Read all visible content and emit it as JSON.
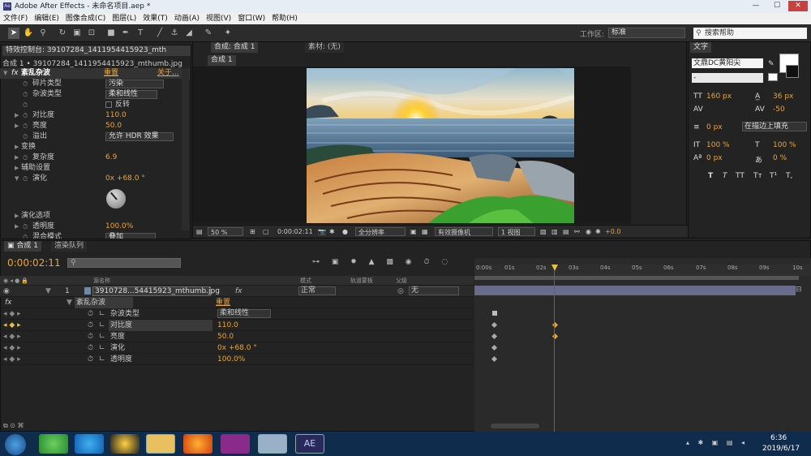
{
  "window": {
    "title": "Adobe After Effects - 未命名项目.aep *"
  },
  "menu": [
    "文件(F)",
    "编辑(E)",
    "图像合成(C)",
    "图层(L)",
    "效果(T)",
    "动画(A)",
    "视图(V)",
    "窗口(W)",
    "帮助(H)"
  ],
  "toolbar": {
    "workspace_label": "工作区:",
    "workspace_value": "标准",
    "search_placeholder": "搜索帮助"
  },
  "effect_controls": {
    "tab": "特效控制台: 39107284_1411954415923_mth",
    "subtitle": "合成 1 • 39107284_1411954415923_mthumb.jpg",
    "effect_name": "紊乱杂波",
    "reset": "重置",
    "about": "关于...",
    "rows": [
      {
        "label": "碎片类型",
        "dropdown": "污染"
      },
      {
        "label": "杂波类型",
        "dropdown": "柔和线性"
      },
      {
        "label": "",
        "checkbox": "反转"
      },
      {
        "label": "对比度",
        "value": "110.0"
      },
      {
        "label": "亮度",
        "value": "50.0"
      },
      {
        "label": "溢出",
        "dropdown": "允许 HDR 效果"
      },
      {
        "label": "变换"
      },
      {
        "label": "复杂度",
        "value": "6.9"
      },
      {
        "label": "辅助设置"
      },
      {
        "label": "演化",
        "value": "0x +68.0 °"
      },
      {
        "label": "演化选项"
      },
      {
        "label": "透明度",
        "value": "100.0%"
      },
      {
        "label": "混合模式",
        "dropdown": "叠加"
      }
    ]
  },
  "composition": {
    "tab": "合成: 合成 1",
    "footage_tab": "素材: (无)",
    "inner_tab": "合成 1",
    "zoom": "50 %",
    "timecode": "0:00:02:11",
    "resolution": "全分辨率",
    "camera": "有效摄像机",
    "views": "1 视图",
    "offset": "+0.0"
  },
  "character": {
    "tab": "文字",
    "font": "文鼎DC黄阳尖",
    "style": "-",
    "size": "160 px",
    "leading": "36 px",
    "kerning": "",
    "tracking": "-50",
    "stroke": "0 px",
    "stroke_mode": "在描边上填充",
    "vscale": "100 %",
    "hscale": "100 %",
    "baseline": "0 px",
    "tsume": "0 %",
    "styles": [
      "T",
      "T",
      "TT",
      "Tт",
      "T¹",
      "T,"
    ]
  },
  "timeline": {
    "tab": "合成 1",
    "render_tab": "渲染队列",
    "timecode": "0:00:02:11",
    "header": {
      "source": "源名称",
      "mode": "模式",
      "track": "轨道蒙板",
      "parent": "父级"
    },
    "ruler": [
      "0:00s",
      "01s",
      "02s",
      "03s",
      "04s",
      "05s",
      "06s",
      "07s",
      "08s",
      "09s",
      "10s"
    ],
    "layer": {
      "index": "1",
      "name": "3910728...54415923_mthumb.jpg",
      "mode": "正常",
      "parent": "无"
    },
    "effect": {
      "name": "紊乱杂波",
      "reset": "重置"
    },
    "props": [
      {
        "name": "杂波类型",
        "value": "柔和线性"
      },
      {
        "name": "对比度",
        "value": "110.0"
      },
      {
        "name": "亮度",
        "value": "50.0"
      },
      {
        "name": "演化",
        "value": "0x +68.0 °"
      },
      {
        "name": "透明度",
        "value": "100.0%"
      }
    ]
  },
  "taskbar": {
    "time": "6:36",
    "date": "2019/6/17",
    "ae_label": "AE"
  }
}
